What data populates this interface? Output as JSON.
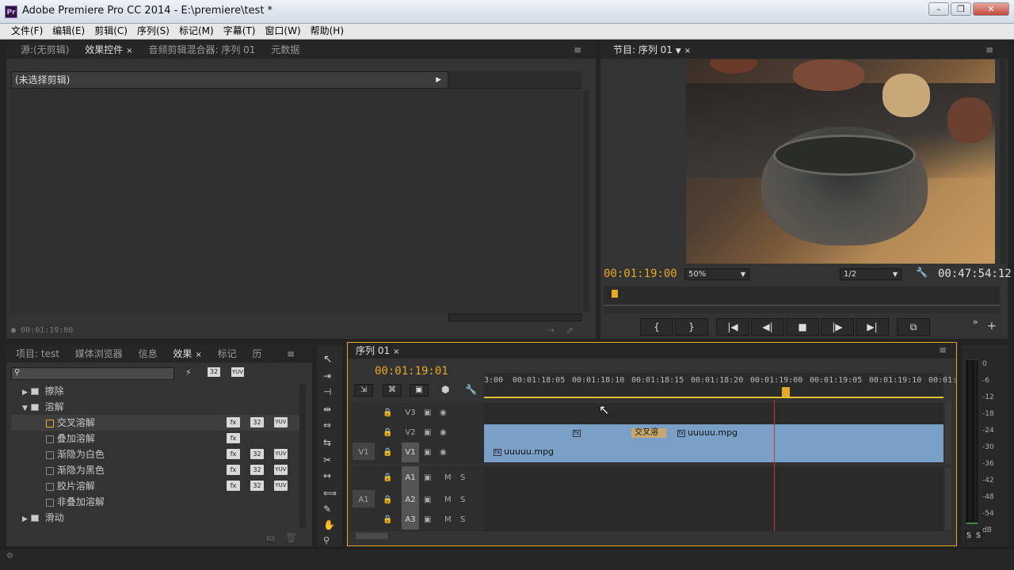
{
  "window": {
    "title": "Adobe Premiere Pro CC 2014 - E:\\premiere\\test *",
    "app_icon": "Pr"
  },
  "menu": [
    "文件(F)",
    "编辑(E)",
    "剪辑(C)",
    "序列(S)",
    "标记(M)",
    "字幕(T)",
    "窗口(W)",
    "帮助(H)"
  ],
  "source_panel": {
    "tabs": [
      "源:(无剪辑)",
      "效果控件",
      "音频剪辑混合器: 序列 01",
      "元数据"
    ],
    "active_tab": 1,
    "no_clip_label": "(未选择剪辑)",
    "timecode": "00:01:19:00"
  },
  "program_monitor": {
    "tab": "节目: 序列 01",
    "current_tc": "00:01:19:00",
    "zoom": "50%",
    "resolution": "1/2",
    "duration_tc": "00:47:54:12"
  },
  "effects_panel": {
    "tabs": [
      "项目: test",
      "媒体浏览器",
      "信息",
      "效果",
      "标记",
      "历"
    ],
    "active_tab": 3,
    "search_placeholder": "",
    "tree": [
      {
        "label": "擦除",
        "type": "folder",
        "expanded": false
      },
      {
        "label": "溶解",
        "type": "folder",
        "expanded": true
      },
      {
        "label": "交叉溶解",
        "type": "item",
        "badges": [
          "fx",
          "32",
          "YUV"
        ],
        "selected": true
      },
      {
        "label": "叠加溶解",
        "type": "item",
        "badges": [
          "fx"
        ]
      },
      {
        "label": "渐隐为白色",
        "type": "item",
        "badges": [
          "fx",
          "32",
          "YUV"
        ]
      },
      {
        "label": "渐隐为黑色",
        "type": "item",
        "badges": [
          "fx",
          "32",
          "YUV"
        ]
      },
      {
        "label": "胶片溶解",
        "type": "item",
        "badges": [
          "fx",
          "32",
          "YUV"
        ]
      },
      {
        "label": "非叠加溶解",
        "type": "item",
        "badges": []
      },
      {
        "label": "滑动",
        "type": "folder",
        "expanded": false
      }
    ]
  },
  "timeline": {
    "tab": "序列 01",
    "timecode": "00:01:19:01",
    "ruler": [
      "3:00",
      "00:01:18:05",
      "00:01:18:10",
      "00:01:18:15",
      "00:01:18:20",
      "00:01:19:00",
      "00:01:19:05",
      "00:01:19:10",
      "00:01:"
    ],
    "video_tracks": [
      {
        "name": "V3",
        "src": ""
      },
      {
        "name": "V2",
        "src": ""
      },
      {
        "name": "V1",
        "src": "V1"
      }
    ],
    "audio_tracks": [
      {
        "name": "A1",
        "src": ""
      },
      {
        "name": "A2",
        "src": "A1"
      },
      {
        "name": "A3",
        "src": ""
      }
    ],
    "clips": {
      "v2_left": "uuuuu.mpg",
      "v2_right": "uuuuu.mpg",
      "v1": "uuuuu.mpg",
      "transition": "交叉溶"
    },
    "m_label": "M",
    "s_label": "S"
  },
  "meter": {
    "scale": [
      "0",
      "-6",
      "-12",
      "-18",
      "-24",
      "-30",
      "-36",
      "-42",
      "-48",
      "-54",
      "dB"
    ],
    "solo_buttons": [
      "S",
      "S"
    ]
  },
  "colors": {
    "accent_timecode": "#e7a826",
    "clip": "#7aa0c8",
    "playhead": "#d03030"
  }
}
